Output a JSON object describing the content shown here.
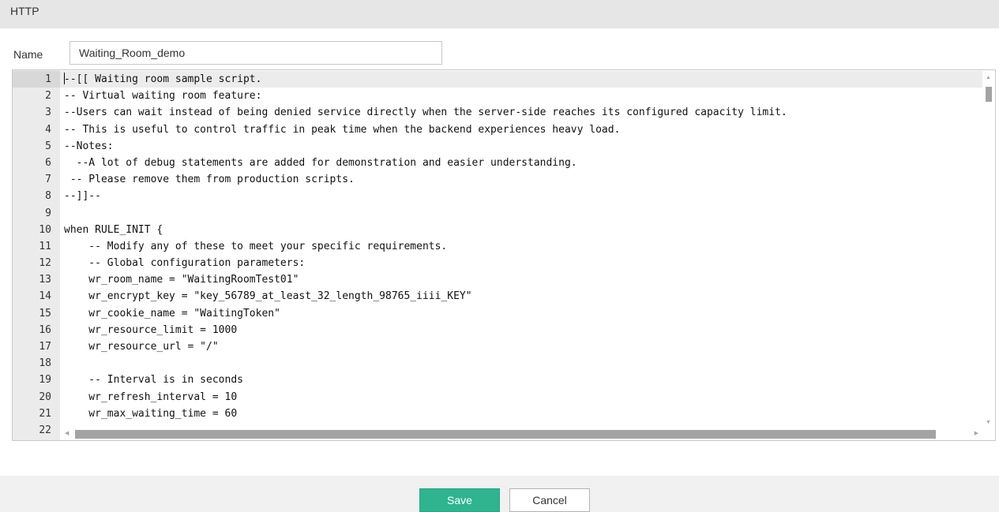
{
  "section": {
    "title": "HTTP"
  },
  "form": {
    "name_label": "Name",
    "name_value": "Waiting_Room_demo"
  },
  "editor": {
    "active_line": 1,
    "lines": [
      {
        "num": "1",
        "text": "--[[ Waiting room sample script."
      },
      {
        "num": "2",
        "text": "-- Virtual waiting room feature:"
      },
      {
        "num": "3",
        "text": "--Users can wait instead of being denied service directly when the server-side reaches its configured capacity limit."
      },
      {
        "num": "4",
        "text": "-- This is useful to control traffic in peak time when the backend experiences heavy load."
      },
      {
        "num": "5",
        "text": "--Notes:"
      },
      {
        "num": "6",
        "text": "  --A lot of debug statements are added for demonstration and easier understanding."
      },
      {
        "num": "7",
        "text": " -- Please remove them from production scripts."
      },
      {
        "num": "8",
        "text": "--]]--"
      },
      {
        "num": "9",
        "text": ""
      },
      {
        "num": "10",
        "text": "when RULE_INIT {"
      },
      {
        "num": "11",
        "text": "    -- Modify any of these to meet your specific requirements."
      },
      {
        "num": "12",
        "text": "    -- Global configuration parameters:"
      },
      {
        "num": "13",
        "text": "    wr_room_name = \"WaitingRoomTest01\""
      },
      {
        "num": "14",
        "text": "    wr_encrypt_key = \"key_56789_at_least_32_length_98765_iiii_KEY\""
      },
      {
        "num": "15",
        "text": "    wr_cookie_name = \"WaitingToken\""
      },
      {
        "num": "16",
        "text": "    wr_resource_limit = 1000"
      },
      {
        "num": "17",
        "text": "    wr_resource_url = \"/\""
      },
      {
        "num": "18",
        "text": ""
      },
      {
        "num": "19",
        "text": "    -- Interval is in seconds"
      },
      {
        "num": "20",
        "text": "    wr_refresh_interval = 10"
      },
      {
        "num": "21",
        "text": "    wr_max_waiting_time = 60"
      },
      {
        "num": "22",
        "text": ""
      }
    ]
  },
  "footer": {
    "save_label": "Save",
    "cancel_label": "Cancel"
  },
  "colors": {
    "save_button": "#2fb48f",
    "header_bg": "#e6e6e6",
    "gutter_bg": "#ebebeb",
    "footer_bg": "#f1f1f1"
  },
  "icons": {
    "scroll_up": "caret-up-icon",
    "scroll_down": "caret-down-icon",
    "scroll_left": "caret-left-icon",
    "scroll_right": "caret-right-icon"
  }
}
